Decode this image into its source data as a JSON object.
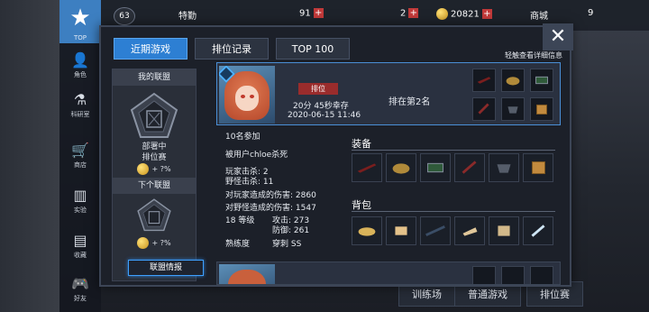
{
  "background": {
    "nav_top_label": "TOP",
    "nav_items": [
      "角色",
      "科研室",
      "商店",
      "实验",
      "收藏",
      "好友"
    ],
    "level": "63",
    "special": "特勤",
    "res1": "91",
    "res2": "2",
    "coins": "20821",
    "shop_label": "商城",
    "res4": "9",
    "bottom_buttons": [
      "训练场",
      "普通游戏",
      "排位赛"
    ]
  },
  "dialog": {
    "tabs": [
      "近期游戏",
      "排位记录",
      "TOP 100"
    ],
    "active_tab": 0,
    "hint": "轻触查看详细信息",
    "close_glyph": "✕"
  },
  "alliance": {
    "my_title": "我的联盟",
    "rank_name": "部署中",
    "season": "排位赛",
    "bonus": "+ ?%",
    "next_title": "下个联盟",
    "next_bonus": "+ ?%",
    "button": "联盟情报"
  },
  "match": {
    "tag": "排位",
    "duration": "20分 45秒幸存",
    "datetime": "2020-06-15 11:46",
    "placement": "排在第2名"
  },
  "details": {
    "participants": "10名参加",
    "killed_by": "被用户chloe杀死",
    "player_kills": "玩家击杀: 2",
    "wild_kills": "野怪击杀: 11",
    "dmg_players": "对玩家造成的伤害: 2860",
    "dmg_wild": "对野怪造成的伤害: 1547",
    "level": "18 等级",
    "attack": "攻击: 273",
    "defense": "防御: 261",
    "proficiency_label": "熟练度",
    "proficiency_value": "穿刺 SS"
  },
  "equipment_title": "装备",
  "backpack_title": "背包"
}
